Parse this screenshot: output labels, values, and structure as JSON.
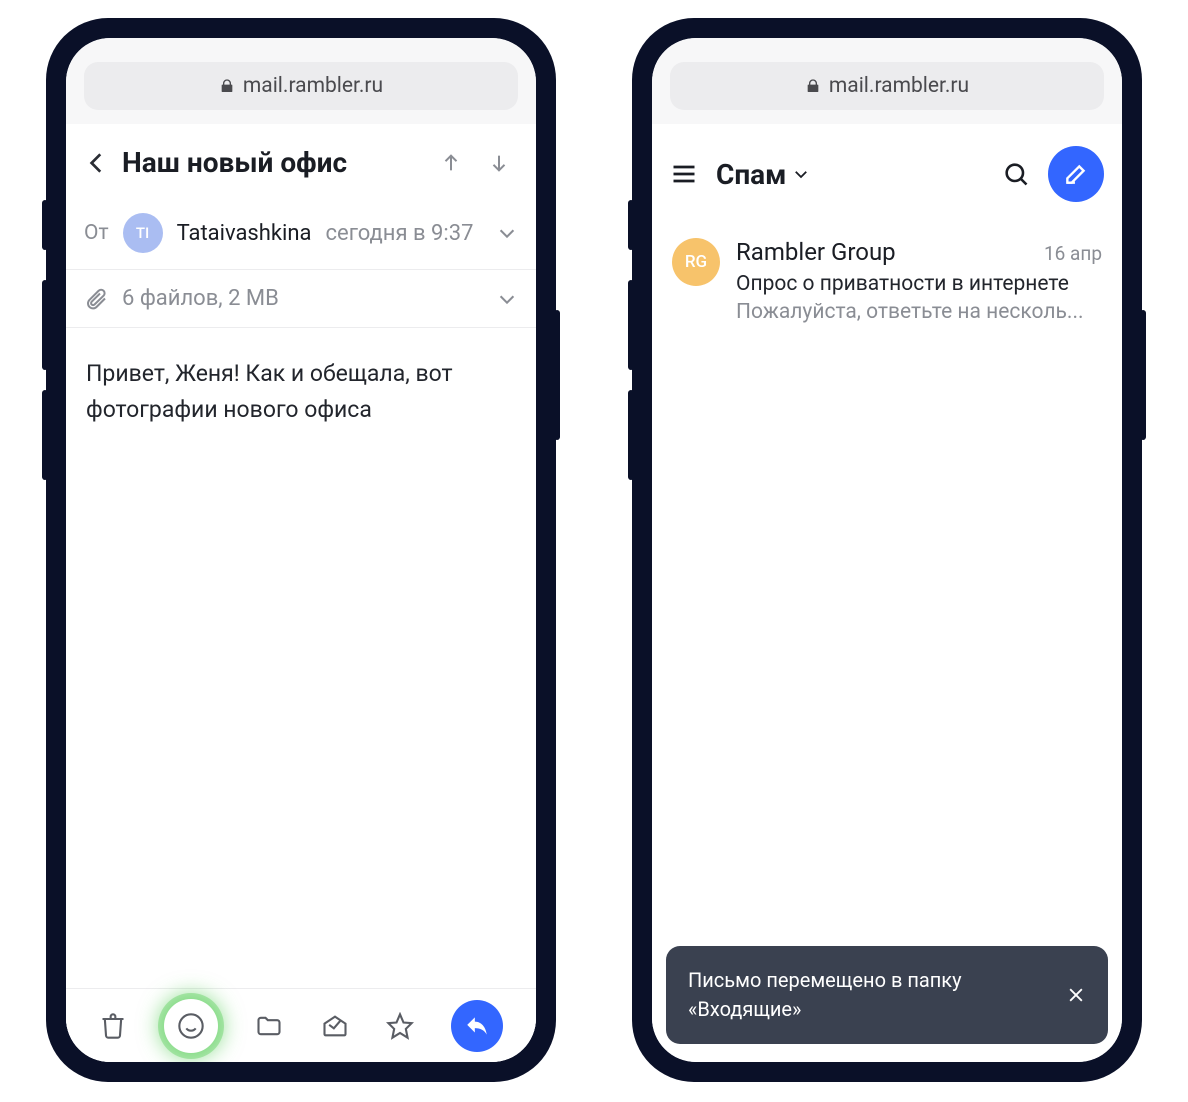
{
  "phone1": {
    "url": "mail.rambler.ru",
    "subject": "Наш новый офис",
    "from_label": "От",
    "avatar_initials": "TI",
    "sender_name": "Tataivashkina",
    "sender_time": "сегодня в 9:37",
    "attachments": "6 файлов, 2 MB",
    "body": "Привет, Женя! Как и обещала, вот фотографии нового офиса"
  },
  "phone2": {
    "url": "mail.rambler.ru",
    "folder": "Спам",
    "item": {
      "avatar_initials": "RG",
      "sender": "Rambler Group",
      "date": "16 апр",
      "subject": "Опрос о приватности в интернете",
      "preview": "Пожалуйста, ответьте на несколь..."
    },
    "toast": "Письмо перемещено в папку «Входящие»"
  }
}
